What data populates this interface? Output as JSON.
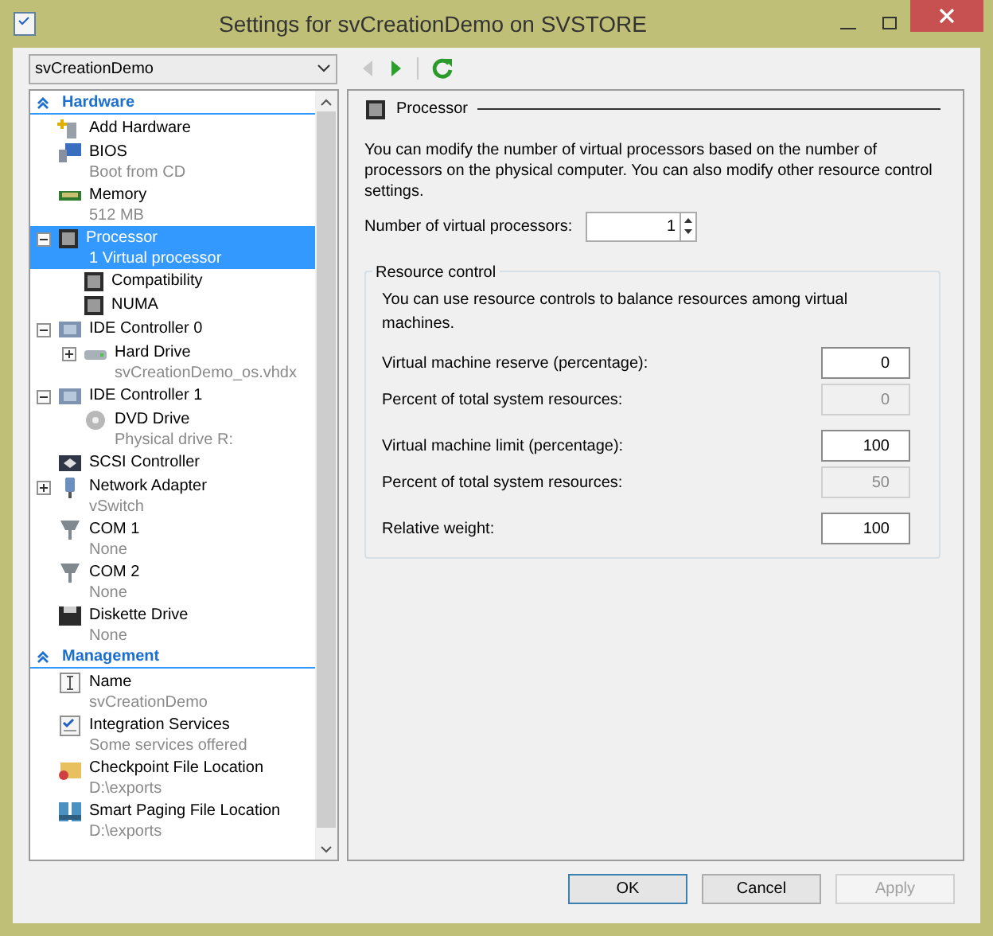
{
  "window": {
    "title": "Settings for svCreationDemo on SVSTORE"
  },
  "toolbar": {
    "vm_select": "svCreationDemo",
    "back_disabled": true,
    "forward_disabled": false
  },
  "tree": {
    "sections": [
      {
        "title": "Hardware",
        "expanded": true,
        "items": [
          {
            "name": "Add Hardware",
            "selected": false
          },
          {
            "name": "BIOS",
            "detail": "Boot from CD",
            "selected": false
          },
          {
            "name": "Memory",
            "detail": "512 MB",
            "selected": false
          },
          {
            "name": "Processor",
            "detail": "1 Virtual processor",
            "selected": true,
            "expanded": true,
            "children": [
              {
                "name": "Compatibility",
                "selected": false
              },
              {
                "name": "NUMA",
                "selected": false
              }
            ]
          },
          {
            "name": "IDE Controller 0",
            "selected": false,
            "expanded": true,
            "children": [
              {
                "name": "Hard Drive",
                "detail": "svCreationDemo_os.vhdx",
                "selected": false,
                "expanded": false
              }
            ]
          },
          {
            "name": "IDE Controller 1",
            "selected": false,
            "expanded": true,
            "children": [
              {
                "name": "DVD Drive",
                "detail": "Physical drive R:",
                "selected": false
              }
            ]
          },
          {
            "name": "SCSI Controller",
            "selected": false
          },
          {
            "name": "Network Adapter",
            "detail": "vSwitch",
            "selected": false,
            "expanded": false
          },
          {
            "name": "COM 1",
            "detail": "None",
            "selected": false
          },
          {
            "name": "COM 2",
            "detail": "None",
            "selected": false
          },
          {
            "name": "Diskette Drive",
            "detail": "None",
            "selected": false
          }
        ]
      },
      {
        "title": "Management",
        "expanded": true,
        "items": [
          {
            "name": "Name",
            "detail": "svCreationDemo",
            "selected": false
          },
          {
            "name": "Integration Services",
            "detail": "Some services offered",
            "selected": false
          },
          {
            "name": "Checkpoint File Location",
            "detail": "D:\\exports",
            "selected": false
          },
          {
            "name": "Smart Paging File Location",
            "detail": "D:\\exports",
            "selected": false
          }
        ]
      }
    ]
  },
  "panel": {
    "heading": "Processor",
    "description": "You can modify the number of virtual processors based on the number of processors on the physical computer. You can also modify other resource control settings.",
    "processors": {
      "label": "Number of virtual processors:",
      "value": "1"
    },
    "resource_control": {
      "title": "Resource control",
      "description": "You can use resource controls to balance resources among virtual machines.",
      "fields": [
        {
          "label": "Virtual machine reserve (percentage):",
          "value": "0",
          "disabled": false
        },
        {
          "label": "Percent of total system resources:",
          "value": "0",
          "disabled": true
        },
        {
          "label": "Virtual machine limit (percentage):",
          "value": "100",
          "disabled": false
        },
        {
          "label": "Percent of total system resources:",
          "value": "50",
          "disabled": true
        },
        {
          "label": "Relative weight:",
          "value": "100",
          "disabled": false
        }
      ]
    }
  },
  "buttons": [
    {
      "label": "OK",
      "default": true,
      "disabled": false
    },
    {
      "label": "Cancel",
      "default": false,
      "disabled": false
    },
    {
      "label": "Apply",
      "default": false,
      "disabled": true
    }
  ]
}
